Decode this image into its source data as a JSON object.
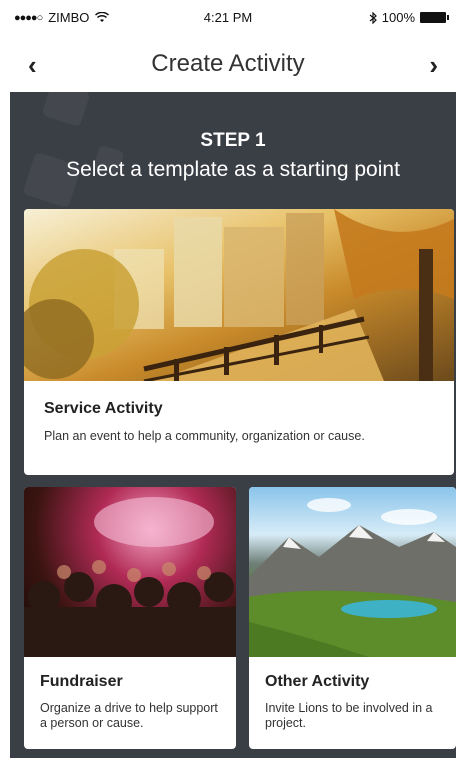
{
  "status_bar": {
    "signal": "●●●●○",
    "carrier": "ZIMBO",
    "wifi_icon": "wifi-icon",
    "time": "4:21 PM",
    "bluetooth_icon": "bluetooth-icon",
    "battery": "100%"
  },
  "nav": {
    "title": "Create Activity",
    "back_icon": "‹",
    "next_icon": "›"
  },
  "step": {
    "label": "STEP 1",
    "subtitle": "Select a template as a starting point"
  },
  "templates": [
    {
      "title": "Service Activity",
      "description": "Plan an event to help a community, organization or cause.",
      "image": "park-walkway-image"
    },
    {
      "title": "Fundraiser",
      "description": "Organize a drive to help support a person or cause.",
      "image": "crowd-event-image"
    },
    {
      "title": "Other Activity",
      "description": "Invite Lions to be involved in a project.",
      "image": "mountain-lake-image"
    }
  ]
}
